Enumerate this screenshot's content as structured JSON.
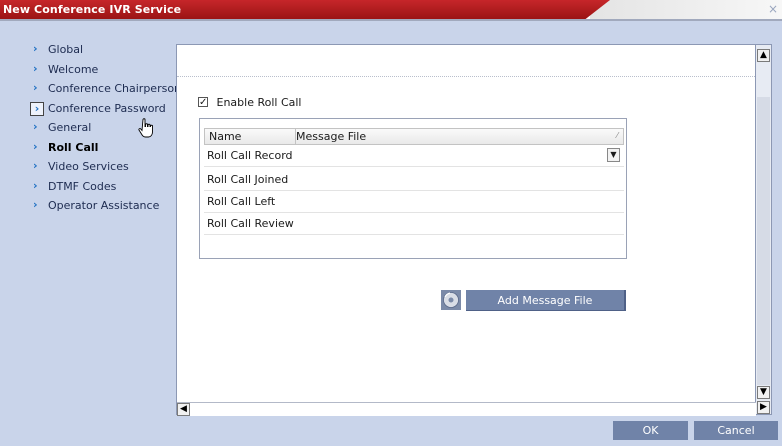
{
  "window": {
    "title": "New Conference IVR Service",
    "close_glyph": "×"
  },
  "sidebar": {
    "items": [
      {
        "label": "Global"
      },
      {
        "label": "Welcome"
      },
      {
        "label": "Conference Chairperson"
      },
      {
        "label": "Conference Password"
      },
      {
        "label": "General"
      },
      {
        "label": "Roll Call"
      },
      {
        "label": "Video Services"
      },
      {
        "label": "DTMF Codes"
      },
      {
        "label": "Operator Assistance"
      }
    ],
    "active_item": "Roll Call",
    "hovered_item": "Conference Password"
  },
  "main": {
    "enable_roll_call": {
      "label": "Enable Roll Call",
      "checked": true,
      "check_glyph": "✓"
    },
    "table": {
      "columns": [
        "Name",
        "Message File"
      ],
      "rows": [
        {
          "name": "Roll Call Record",
          "message_file": ""
        },
        {
          "name": "Roll Call Joined",
          "message_file": ""
        },
        {
          "name": "Roll Call Left",
          "message_file": ""
        },
        {
          "name": "Roll Call Review",
          "message_file": ""
        }
      ]
    },
    "add_message_file_label": "Add Message File",
    "icons": {
      "add_message_file": "cd-disc-icon",
      "dropdown": "chevron-down-icon"
    }
  },
  "footer": {
    "ok_label": "OK",
    "cancel_label": "Cancel"
  },
  "colors": {
    "title_bar": "#b01c1f",
    "button": "#7083a8",
    "background": "#c9d4ea",
    "chevron": "#1e6fc2"
  }
}
